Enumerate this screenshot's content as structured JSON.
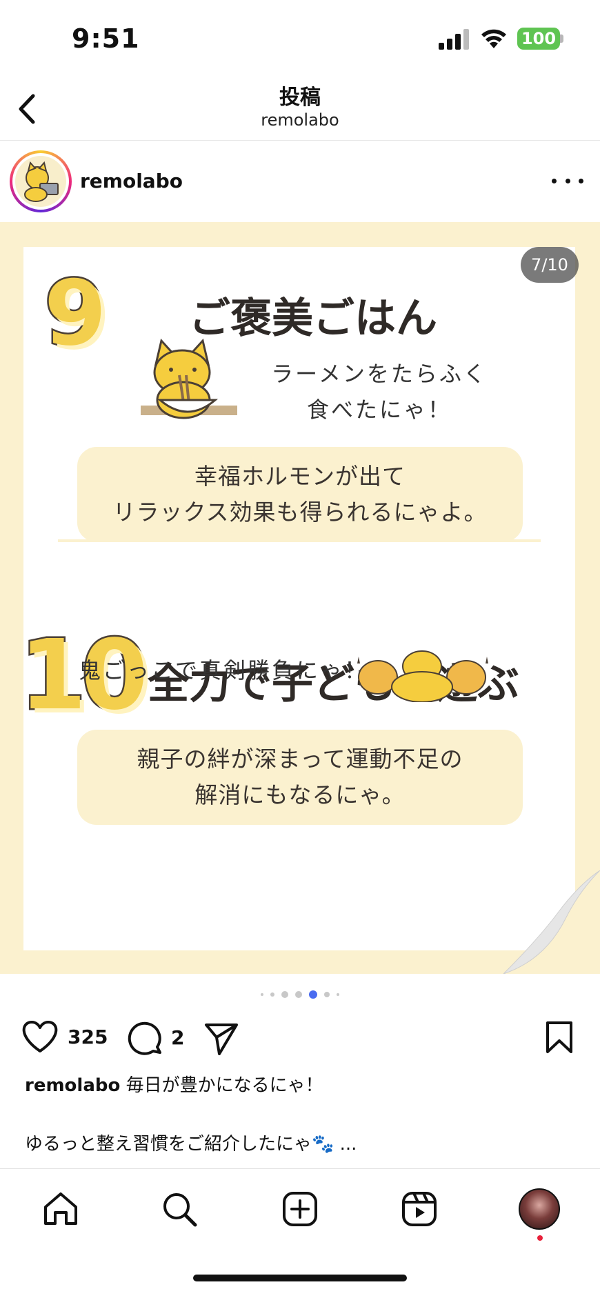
{
  "status_bar": {
    "time": "9:51",
    "battery": "100"
  },
  "header": {
    "title": "投稿",
    "subtitle": "remolabo"
  },
  "post": {
    "username": "remolabo",
    "image_counter": "7/10",
    "slide": {
      "item9": {
        "number": "9",
        "title": "ご褒美ごはん",
        "speech_line1": "ラーメンをたらふく",
        "speech_line2": "食べたにゃ！",
        "note_line1": "幸福ホルモンが出て",
        "note_line2": "リラックス効果も得られるにゃよ。"
      },
      "item10": {
        "number": "10",
        "title": "全力で子どもと遊ぶ",
        "speech": "鬼ごっこで真剣勝負にゃ！",
        "note_line1": "親子の絆が深まって運動不足の",
        "note_line2": "解消にもなるにゃ。"
      }
    },
    "carousel": {
      "total_visible_dots": 7,
      "active_index": 4
    },
    "likes": "325",
    "comments": "2",
    "caption_username": "remolabo",
    "caption_text": "毎日が豊かになるにゃ！",
    "caption_line2": "ゆるっと整え習慣をご紹介したにゃ🐾 ..."
  },
  "colors": {
    "accent": "#f3cf4d",
    "card_bg": "#fbf1cf",
    "active_dot": "#4a6cf0",
    "battery": "#5fc452"
  },
  "icons": {
    "back": "chevron-left-icon",
    "more": "more-horizontal-icon",
    "like": "heart-icon",
    "comment": "comment-icon",
    "share": "paper-plane-icon",
    "save": "bookmark-icon",
    "home": "home-icon",
    "search": "search-icon",
    "create": "plus-square-icon",
    "reels": "reels-icon"
  }
}
